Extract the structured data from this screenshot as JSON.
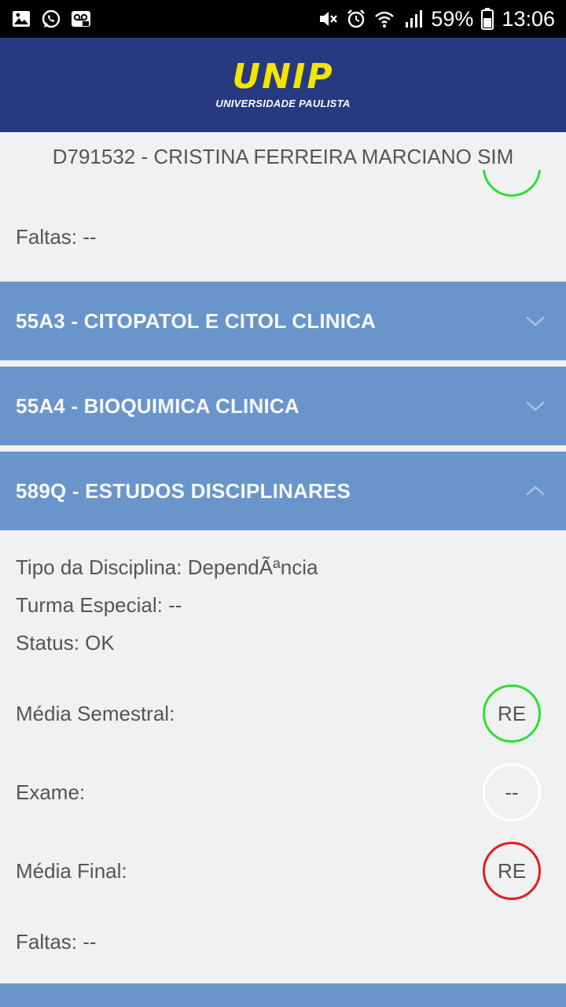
{
  "status_bar": {
    "battery": "59%",
    "time": "13:06",
    "icons_left": [
      "image-icon",
      "whatsapp-icon",
      "voicemail-icon"
    ],
    "icons_right": [
      "mute-icon",
      "alarm-icon",
      "wifi-icon",
      "signal-icon",
      "battery-icon"
    ]
  },
  "header": {
    "logo_main": "UNIP",
    "logo_sub": "UNIVERSIDADE PAULISTA",
    "colors": {
      "background": "#273a80",
      "logo": "#f5e400"
    }
  },
  "student": {
    "label": "D791532 - CRISTINA FERREIRA MARCIANO SIM"
  },
  "previous_section": {
    "faltas": "Faltas: --"
  },
  "disciplines": [
    {
      "title": "55A3 - CITOPATOL E CITOL CLINICA",
      "expanded": false
    },
    {
      "title": "55A4 - BIOQUIMICA CLINICA",
      "expanded": false
    },
    {
      "title": "589Q - ESTUDOS DISCIPLINARES",
      "expanded": true
    }
  ],
  "expanded_details": {
    "tipo": "Tipo da Disciplina: DependÃªncia",
    "turma": "Turma Especial: --",
    "status": "Status: OK",
    "media_semestral_label": "Média Semestral:",
    "media_semestral_value": "RE",
    "exame_label": "Exame:",
    "exame_value": "--",
    "media_final_label": "Média Final:",
    "media_final_value": "RE",
    "faltas": "Faltas: --"
  },
  "colors": {
    "panel": "#6a95cb",
    "pass_circle": "#2ee02e",
    "fail_circle": "#e31e1e",
    "page_bg": "#f0f1f3"
  }
}
